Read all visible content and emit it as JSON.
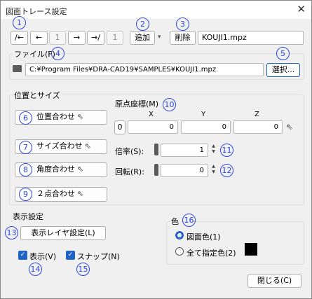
{
  "window": {
    "title": "図面トレース設定",
    "close_glyph": "✕"
  },
  "toolbar": {
    "first": "/←",
    "prev": "←",
    "page": "1",
    "next": "→",
    "last": "→/",
    "count": "1",
    "add": "追加",
    "add_arrow": "▾",
    "delete": "削除",
    "filename": "KOUJI1.mpz"
  },
  "file": {
    "label": "ファイル(F)",
    "path": "C:¥Program Files¥DRA-CAD19¥SAMPLES¥KOUJI1.mpz",
    "select": "選択..."
  },
  "position": {
    "group": "位置とサイズ",
    "pos_align": "位置合わせ",
    "size_align": "サイズ合わせ",
    "angle_align": "角度合わせ",
    "two_point": "２点合わせ"
  },
  "origin": {
    "label": "原点座標(M)",
    "x_label": "X",
    "y_label": "Y",
    "z_label": "Z",
    "zero_btn": "0",
    "x": "0",
    "y": "0",
    "z": "0"
  },
  "scale": {
    "label": "倍率(S):",
    "value": "1"
  },
  "rotate": {
    "label": "回転(R):",
    "value": "0"
  },
  "display": {
    "group": "表示設定",
    "layer_btn": "表示レイヤ設定(L)",
    "show": "表示(V)",
    "snap": "スナップ(N)"
  },
  "color": {
    "group": "色",
    "drawing": "図面色(1)",
    "all": "全て指定色(2)",
    "swatch": "#000000"
  },
  "footer": {
    "close": "閉じる(C)"
  },
  "markers": {
    "m1": "1",
    "m2": "2",
    "m3": "3",
    "m4": "4",
    "m5": "5",
    "m6": "6",
    "m7": "7",
    "m8": "8",
    "m9": "9",
    "m10": "10",
    "m11": "11",
    "m12": "12",
    "m13": "13",
    "m14": "14",
    "m15": "15",
    "m16": "16"
  }
}
